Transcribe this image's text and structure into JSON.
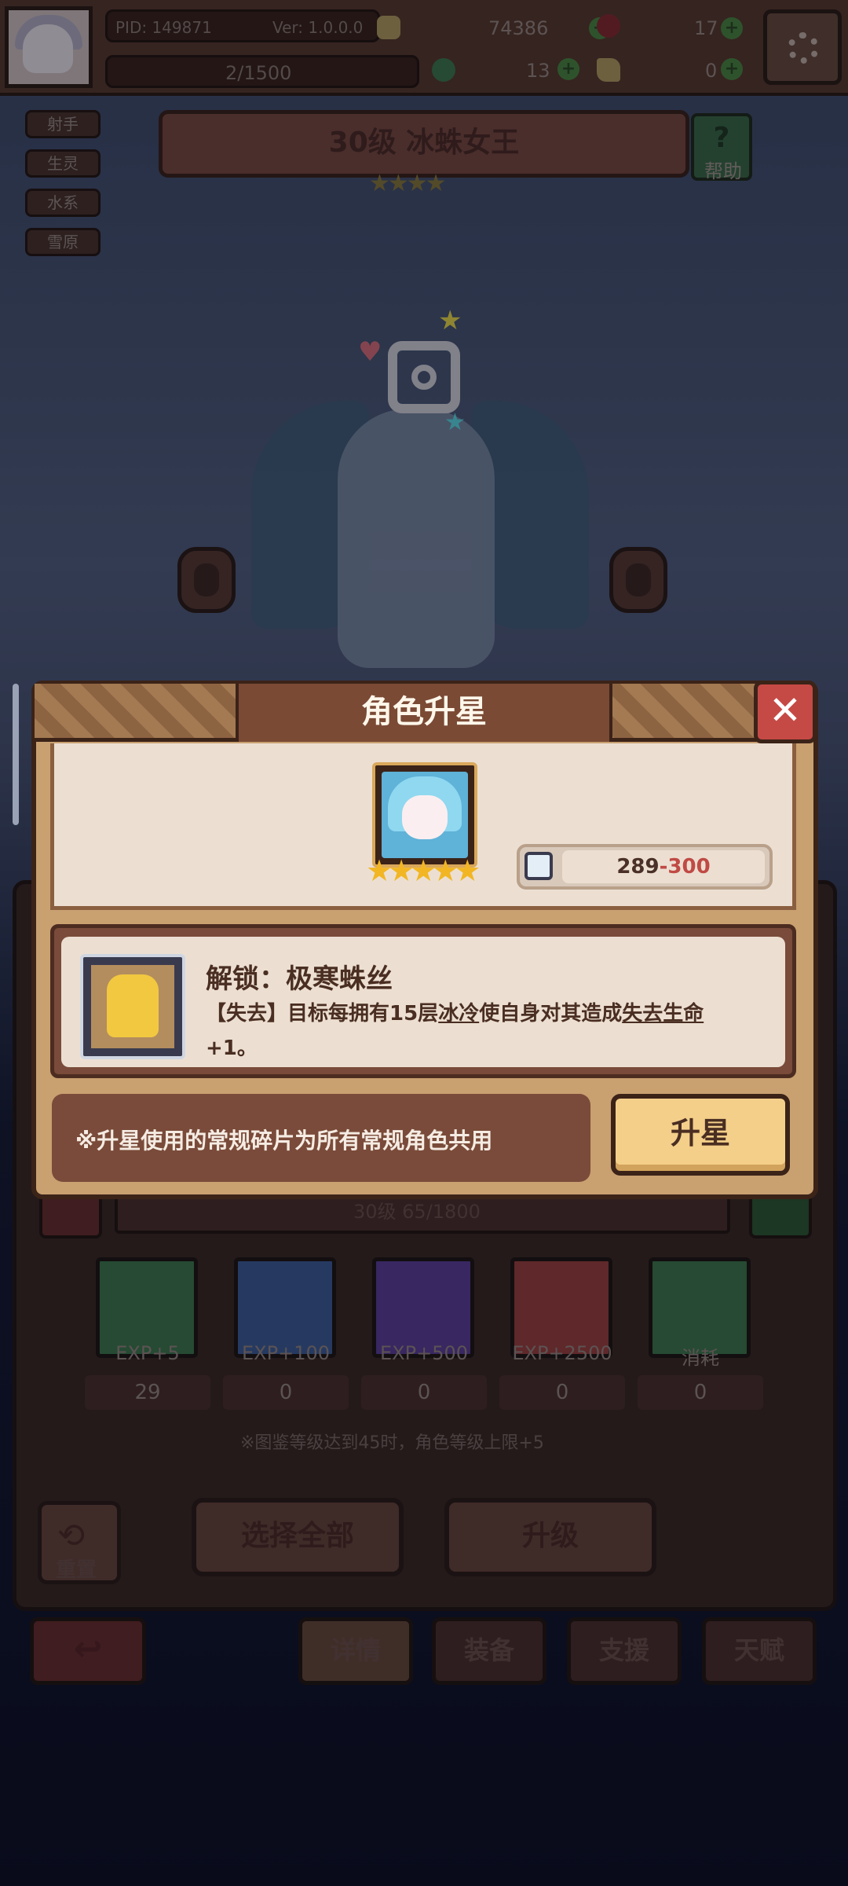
{
  "topbar": {
    "pid": "PID: 149871",
    "version": "Ver: 1.0.0.0",
    "exp_progress": "2/1500",
    "gold": "74386",
    "gems": "17",
    "clover": "13",
    "keys": "0"
  },
  "tags": [
    "射手",
    "生灵",
    "水系",
    "雪原"
  ],
  "hero": {
    "title": "30级 冰蛛女王",
    "stars": 4
  },
  "help": {
    "label": "帮助"
  },
  "modal": {
    "title": "角色升星",
    "shards_have": "289",
    "shards_sep": "-",
    "shards_need": "300",
    "stars": 5,
    "skill_title": "解锁：极寒蛛丝",
    "skill_desc_1": "【失去】目标每拥有15层",
    "skill_desc_kw1": "冰冷",
    "skill_desc_2": "使自身对其造成",
    "skill_desc_kw2": "失去生命",
    "skill_desc_3": "+1。",
    "note": "※升星使用的常规碎片为所有常规角色共用",
    "upgrade_button": "升星"
  },
  "lower": {
    "level_text": "30级 65/1800",
    "items": [
      {
        "label": "EXP+5",
        "count": "29",
        "color": "#3f7a4a"
      },
      {
        "label": "EXP+100",
        "count": "0",
        "color": "#3f5f9a"
      },
      {
        "label": "EXP+500",
        "count": "0",
        "color": "#5e3f9a"
      },
      {
        "label": "EXP+2500",
        "count": "0",
        "color": "#a0403c"
      },
      {
        "label": "消耗",
        "count": "0",
        "color": "#3f7a4a"
      }
    ],
    "hint": "※图鉴等级达到45时，角色等级上限+5",
    "reset_label": "重置",
    "select_all": "选择全部",
    "level_up": "升级"
  },
  "nav": {
    "details": "详情",
    "equip": "装备",
    "support": "支援",
    "talent": "天赋"
  },
  "colors": {
    "accent": "#c54a45",
    "panel": "#ecdfd2",
    "frame": "#3b2318",
    "star": "#f2b624"
  }
}
